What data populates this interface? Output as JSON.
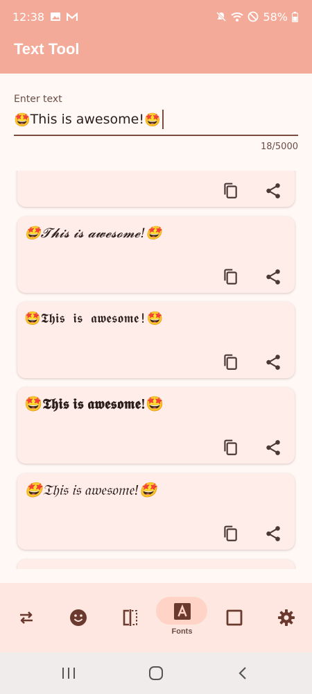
{
  "status_bar": {
    "time": "12:38",
    "battery": "58%",
    "left_icons": [
      "image-icon",
      "gmail-icon"
    ],
    "right_icons": [
      "mute-icon",
      "wifi-icon",
      "dnd-icon",
      "battery-icon"
    ]
  },
  "app_bar": {
    "title": "Text Tool"
  },
  "input": {
    "label": "Enter text",
    "emoji": "🤩",
    "value": "This is awesome!",
    "counter": "18/5000"
  },
  "cards": [
    {
      "text": ""
    },
    {
      "text": "🤩𝓣𝓱𝓲𝓼 𝓲𝓼 𝓪𝔀𝓮𝓼𝓸𝓶𝓮!🤩"
    },
    {
      "text": "🤩𝕿𝖍𝖎𝖘 𝖎𝖘 𝖆𝖜𝖊𝖘𝖔𝖒𝖊!🤩"
    },
    {
      "text": "🤩𝕿𝖍𝖎𝖘 𝖎𝖘 𝖆𝖜𝖊𝖘𝖔𝖒𝖊!🤩"
    },
    {
      "text": "🤩𝔗𝔥𝔦𝔰 𝔦𝔰 𝔞𝔴𝔢𝔰𝔬𝔪𝔢!🤩"
    },
    {
      "text": ""
    }
  ],
  "card_actions": {
    "copy_icon": "copy-icon",
    "share_icon": "share-icon"
  },
  "bottom_nav": {
    "items": [
      {
        "icon": "swap-icon",
        "label": ""
      },
      {
        "icon": "emoji-icon",
        "label": ""
      },
      {
        "icon": "mirror-icon",
        "label": ""
      },
      {
        "icon": "font-icon",
        "label": "Fonts",
        "active": true
      },
      {
        "icon": "frame-icon",
        "label": ""
      },
      {
        "icon": "settings-icon",
        "label": ""
      }
    ]
  },
  "system_nav": {
    "buttons": [
      "recents-icon",
      "home-icon",
      "back-icon"
    ]
  },
  "colors": {
    "app_bar": "#f4aa98",
    "background": "#fff8f5",
    "card": "#ffedea",
    "accent": "#7a4b3e",
    "nav_bar": "#fde7e0",
    "active_pill": "#ffd4c6"
  }
}
